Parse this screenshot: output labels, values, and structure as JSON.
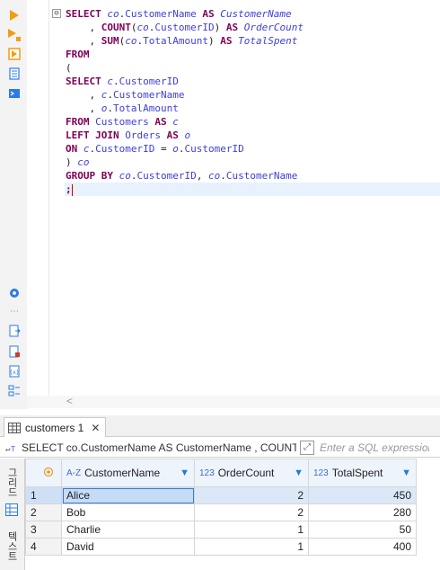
{
  "toolbar": {
    "icons": [
      "execute-statement-icon",
      "execute-script-icon",
      "execute-in-new-tab-icon",
      "explain-plan-icon",
      "load-script-icon",
      "settings-icon",
      "more-icon",
      "export-icon",
      "save-icon",
      "format-icon",
      "layout-icon"
    ]
  },
  "editor": {
    "fold_marker": "⊖",
    "lines": [
      {
        "parts": [
          [
            "kw",
            "SELECT "
          ],
          [
            "al",
            "co"
          ],
          [
            "txt",
            "."
          ],
          [
            "col",
            "CustomerName "
          ],
          [
            "kw",
            "AS "
          ],
          [
            "al",
            "CustomerName"
          ]
        ]
      },
      {
        "parts": [
          [
            "txt",
            "    , "
          ],
          [
            "kw",
            "COUNT"
          ],
          [
            "txt",
            "("
          ],
          [
            "al",
            "co"
          ],
          [
            "txt",
            "."
          ],
          [
            "col",
            "CustomerID"
          ],
          [
            "txt",
            ") "
          ],
          [
            "kw",
            "AS "
          ],
          [
            "al",
            "OrderCount"
          ]
        ]
      },
      {
        "parts": [
          [
            "txt",
            "    , "
          ],
          [
            "kw",
            "SUM"
          ],
          [
            "txt",
            "("
          ],
          [
            "al",
            "co"
          ],
          [
            "txt",
            "."
          ],
          [
            "col",
            "TotalAmount"
          ],
          [
            "txt",
            ") "
          ],
          [
            "kw",
            "AS "
          ],
          [
            "al",
            "TotalSpent"
          ]
        ]
      },
      {
        "parts": [
          [
            "kw",
            "FROM"
          ]
        ]
      },
      {
        "parts": [
          [
            "txt",
            "("
          ]
        ]
      },
      {
        "parts": [
          [
            "kw",
            "SELECT "
          ],
          [
            "al",
            "c"
          ],
          [
            "txt",
            "."
          ],
          [
            "col",
            "CustomerID"
          ]
        ]
      },
      {
        "parts": [
          [
            "txt",
            "    , "
          ],
          [
            "al",
            "c"
          ],
          [
            "txt",
            "."
          ],
          [
            "col",
            "CustomerName"
          ]
        ]
      },
      {
        "parts": [
          [
            "txt",
            "    , "
          ],
          [
            "al",
            "o"
          ],
          [
            "txt",
            "."
          ],
          [
            "col",
            "TotalAmount"
          ]
        ]
      },
      {
        "parts": [
          [
            "kw",
            "FROM "
          ],
          [
            "tb-name",
            "Customers "
          ],
          [
            "kw",
            "AS "
          ],
          [
            "al",
            "c"
          ]
        ]
      },
      {
        "parts": [
          [
            "kw",
            "LEFT JOIN "
          ],
          [
            "tb-name",
            "Orders "
          ],
          [
            "kw",
            "AS "
          ],
          [
            "al",
            "o"
          ]
        ]
      },
      {
        "parts": [
          [
            "kw",
            "ON "
          ],
          [
            "al",
            "c"
          ],
          [
            "txt",
            "."
          ],
          [
            "col",
            "CustomerID "
          ],
          [
            "txt",
            "= "
          ],
          [
            "al",
            "o"
          ],
          [
            "txt",
            "."
          ],
          [
            "col",
            "CustomerID"
          ]
        ]
      },
      {
        "parts": [
          [
            "txt",
            ") "
          ],
          [
            "al",
            "co"
          ]
        ]
      },
      {
        "parts": [
          [
            "kw",
            "GROUP BY "
          ],
          [
            "al",
            "co"
          ],
          [
            "txt",
            "."
          ],
          [
            "col",
            "CustomerID"
          ],
          [
            "txt",
            ", "
          ],
          [
            "al",
            "co"
          ],
          [
            "txt",
            "."
          ],
          [
            "col",
            "CustomerName"
          ]
        ]
      },
      {
        "parts": [
          [
            "kw",
            ";"
          ]
        ],
        "active": true
      }
    ],
    "scroll_left": "<"
  },
  "results": {
    "tab_label": "customers 1",
    "tab_close": "✕",
    "filter_sql": "SELECT co.CustomerName AS CustomerName , COUNT(",
    "filter_placeholder": "Enter a SQL expression",
    "side_tabs": [
      "그리드",
      "텍스트"
    ],
    "columns": [
      {
        "type": "A-Z",
        "name": "CustomerName"
      },
      {
        "type": "123",
        "name": "OrderCount"
      },
      {
        "type": "123",
        "name": "TotalSpent"
      }
    ],
    "rows": [
      {
        "num": "1",
        "CustomerName": "Alice",
        "OrderCount": "2",
        "TotalSpent": "450"
      },
      {
        "num": "2",
        "CustomerName": "Bob",
        "OrderCount": "2",
        "TotalSpent": "280"
      },
      {
        "num": "3",
        "CustomerName": "Charlie",
        "OrderCount": "1",
        "TotalSpent": "50"
      },
      {
        "num": "4",
        "CustomerName": "David",
        "OrderCount": "1",
        "TotalSpent": "400"
      }
    ]
  }
}
